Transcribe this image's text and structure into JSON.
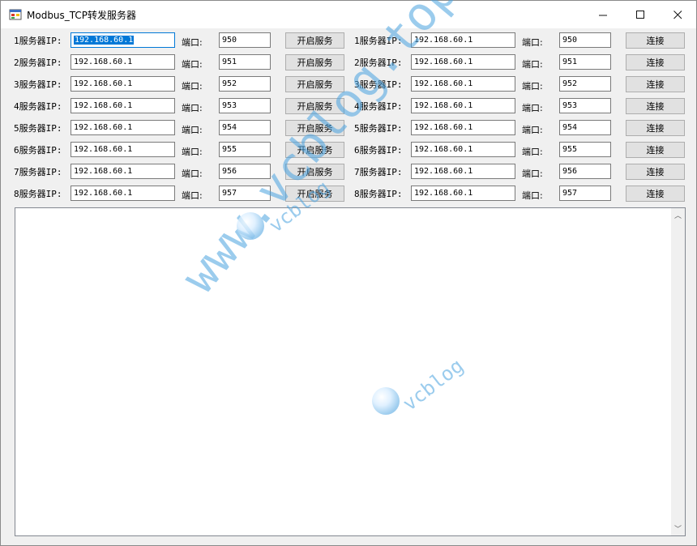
{
  "window": {
    "title": "Modbus_TCP转发服务器"
  },
  "left_rows": [
    {
      "label": "1服务器IP:",
      "ip": "192.168.60.1",
      "port_label": "端口:",
      "port": "950",
      "button": "开启服务"
    },
    {
      "label": "2服务器IP:",
      "ip": "192.168.60.1",
      "port_label": "端口:",
      "port": "951",
      "button": "开启服务"
    },
    {
      "label": "3服务器IP:",
      "ip": "192.168.60.1",
      "port_label": "端口:",
      "port": "952",
      "button": "开启服务"
    },
    {
      "label": "4服务器IP:",
      "ip": "192.168.60.1",
      "port_label": "端口:",
      "port": "953",
      "button": "开启服务"
    },
    {
      "label": "5服务器IP:",
      "ip": "192.168.60.1",
      "port_label": "端口:",
      "port": "954",
      "button": "开启服务"
    },
    {
      "label": "6服务器IP:",
      "ip": "192.168.60.1",
      "port_label": "端口:",
      "port": "955",
      "button": "开启服务"
    },
    {
      "label": "7服务器IP:",
      "ip": "192.168.60.1",
      "port_label": "端口:",
      "port": "956",
      "button": "开启服务"
    },
    {
      "label": "8服务器IP:",
      "ip": "192.168.60.1",
      "port_label": "端口:",
      "port": "957",
      "button": "开启服务"
    }
  ],
  "right_rows": [
    {
      "label": "1服务器IP:",
      "ip": "192.168.60.1",
      "port_label": "端口:",
      "port": "950",
      "button": "连接"
    },
    {
      "label": "2服务器IP:",
      "ip": "192.168.60.1",
      "port_label": "端口:",
      "port": "951",
      "button": "连接"
    },
    {
      "label": "3服务器IP:",
      "ip": "192.168.60.1",
      "port_label": "端口:",
      "port": "952",
      "button": "连接"
    },
    {
      "label": "4服务器IP:",
      "ip": "192.168.60.1",
      "port_label": "端口:",
      "port": "953",
      "button": "连接"
    },
    {
      "label": "5服务器IP:",
      "ip": "192.168.60.1",
      "port_label": "端口:",
      "port": "954",
      "button": "连接"
    },
    {
      "label": "6服务器IP:",
      "ip": "192.168.60.1",
      "port_label": "端口:",
      "port": "955",
      "button": "连接"
    },
    {
      "label": "7服务器IP:",
      "ip": "192.168.60.1",
      "port_label": "端口:",
      "port": "956",
      "button": "连接"
    },
    {
      "label": "8服务器IP:",
      "ip": "192.168.60.1",
      "port_label": "端口:",
      "port": "957",
      "button": "连接"
    }
  ],
  "watermark": {
    "main": "www.vcblog.top",
    "small": "vcblog"
  },
  "colors": {
    "accent": "#0078d7",
    "watermark": "#4aa3e0"
  },
  "icons": {
    "app": "app-window-icon",
    "minimize": "minimize-icon",
    "maximize": "maximize-icon",
    "close": "close-icon"
  }
}
